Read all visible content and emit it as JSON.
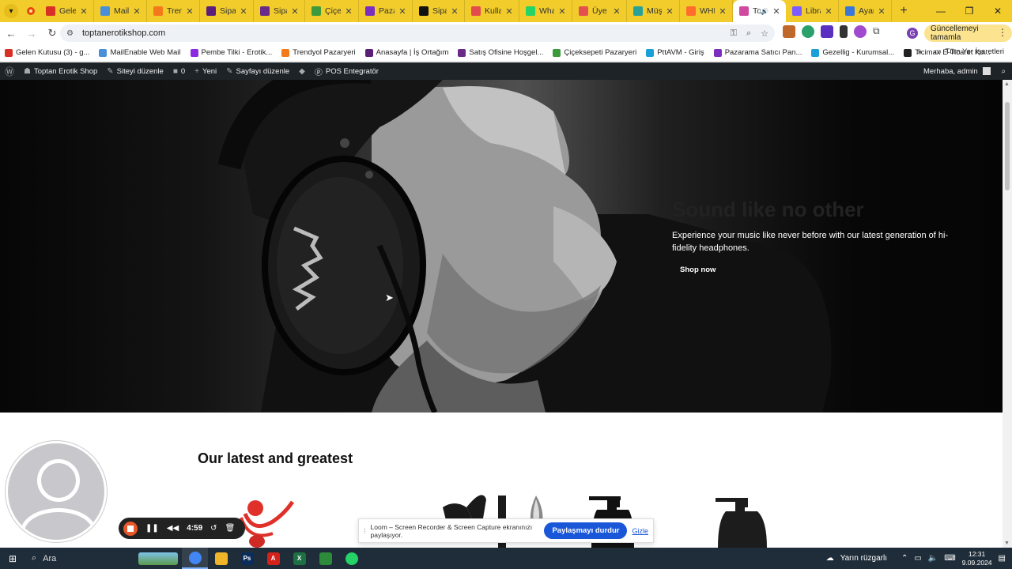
{
  "browser": {
    "tabs": [
      {
        "title": "Gelen",
        "color": "#d93025"
      },
      {
        "title": "MailE",
        "color": "#4a90d9"
      },
      {
        "title": "Trend",
        "color": "#f27a1a"
      },
      {
        "title": "Sipari",
        "color": "#5b1f7a"
      },
      {
        "title": "Sipari",
        "color": "#6a2a8a"
      },
      {
        "title": "Çiçek",
        "color": "#3c9a3c"
      },
      {
        "title": "Pazar",
        "color": "#7b2fbf"
      },
      {
        "title": "Sipari",
        "color": "#111111"
      },
      {
        "title": "Kulla",
        "color": "#e24c4c"
      },
      {
        "title": "What",
        "color": "#25d366"
      },
      {
        "title": "Üye C",
        "color": "#e35050"
      },
      {
        "title": "Müşt",
        "color": "#2aa198"
      },
      {
        "title": "WHM",
        "color": "#ff6c2c"
      },
      {
        "title": "To",
        "color": "#d04aa0"
      },
      {
        "title": "Libra",
        "color": "#7a5cff"
      },
      {
        "title": "Ayarl",
        "color": "#3b77d9"
      }
    ],
    "url": "toptanerotikshop.com",
    "update_label": "Güncellemeyi tamamla",
    "profile_letter": "G",
    "bookmarks": [
      {
        "label": "Gelen Kutusu (3) - g...",
        "color": "#d93025"
      },
      {
        "label": "MailEnable Web Mail",
        "color": "#4a90d9"
      },
      {
        "label": "Pembe Tilki - Erotik...",
        "color": "#8a2be2"
      },
      {
        "label": "Trendyol Pazaryeri",
        "color": "#f27a1a"
      },
      {
        "label": "Anasayfa | İş Ortağım",
        "color": "#5b1f7a"
      },
      {
        "label": "Satış Ofisine Hoşgel...",
        "color": "#6a2a8a"
      },
      {
        "label": "Çiçeksepeti Pazaryeri",
        "color": "#3c9a3c"
      },
      {
        "label": "PttAVM - Giriş",
        "color": "#1a9fd9"
      },
      {
        "label": "Pazarama Satıcı Pan...",
        "color": "#7b2fbf"
      },
      {
        "label": "Gezellig - Kurumsal...",
        "color": "#1a9fd9"
      },
      {
        "label": "Ticimax E-Ticaret Ko...",
        "color": "#222222"
      }
    ],
    "all_bookmarks_label": "Tüm Yer İşaretleri"
  },
  "adminbar": {
    "site_name": "Toptan Erotik Shop",
    "customize": "Siteyi düzenle",
    "comments": "0",
    "new": "Yeni",
    "edit_page": "Sayfayı düzenle",
    "pos": "POS Entegratör",
    "greeting": "Merhaba, admin"
  },
  "hero": {
    "title": "Sound like no other",
    "text": "Experience your music like never before with our latest generation of hi-fidelity headphones.",
    "button": "Shop now"
  },
  "section": {
    "title": "Our latest and greatest"
  },
  "loom": {
    "timer": "4:59",
    "share_text": "Loom – Screen Recorder & Screen Capture ekranınızı paylaşıyor.",
    "stop_share": "Paylaşmayı durdur",
    "hide": "Gizle"
  },
  "taskbar": {
    "search": "Ara",
    "weather": "Yarın rüzgarlı",
    "time": "12:31",
    "date": "9.09.2024",
    "apps": [
      {
        "name": "chrome",
        "color": "#4285f4",
        "label": ""
      },
      {
        "name": "explorer",
        "color": "#f0b429",
        "label": ""
      },
      {
        "name": "photoshop",
        "color": "#0b2d5c",
        "label": "Ps"
      },
      {
        "name": "acrobat",
        "color": "#d4221b",
        "label": "A"
      },
      {
        "name": "excel",
        "color": "#1d7044",
        "label": "X"
      },
      {
        "name": "app-green",
        "color": "#2c8a3a",
        "label": ""
      },
      {
        "name": "whatsapp",
        "color": "#25d366",
        "label": ""
      }
    ]
  }
}
